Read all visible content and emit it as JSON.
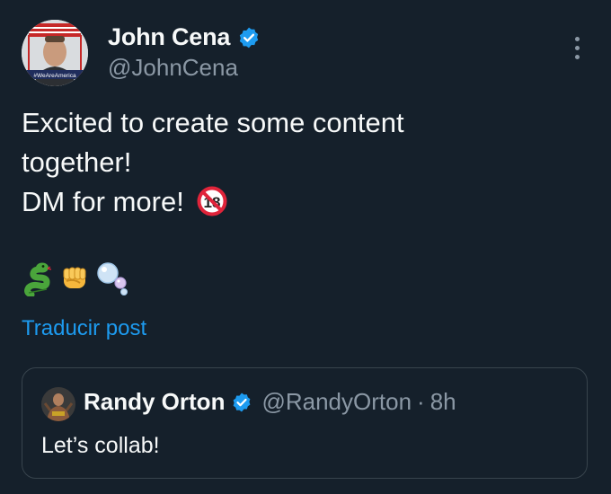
{
  "author": {
    "display_name": "John Cena",
    "handle": "@JohnCena",
    "avatar_caption": "#WeAreAmerica"
  },
  "tweet": {
    "lines": [
      "Excited to create some content",
      "together!",
      "DM for more!"
    ],
    "emoji": [
      "snake",
      "raised-fist",
      "bubbles"
    ]
  },
  "translate_label": "Traducir post",
  "quoted": {
    "display_name": "Randy Orton",
    "handle": "@RandyOrton",
    "separator": "·",
    "time": "8h",
    "text": "Let’s collab!"
  },
  "colors": {
    "background": "#15202b",
    "verified": "#1d9bf0",
    "link": "#1d9bf0",
    "muted": "#8b98a5",
    "border": "#38444d"
  }
}
